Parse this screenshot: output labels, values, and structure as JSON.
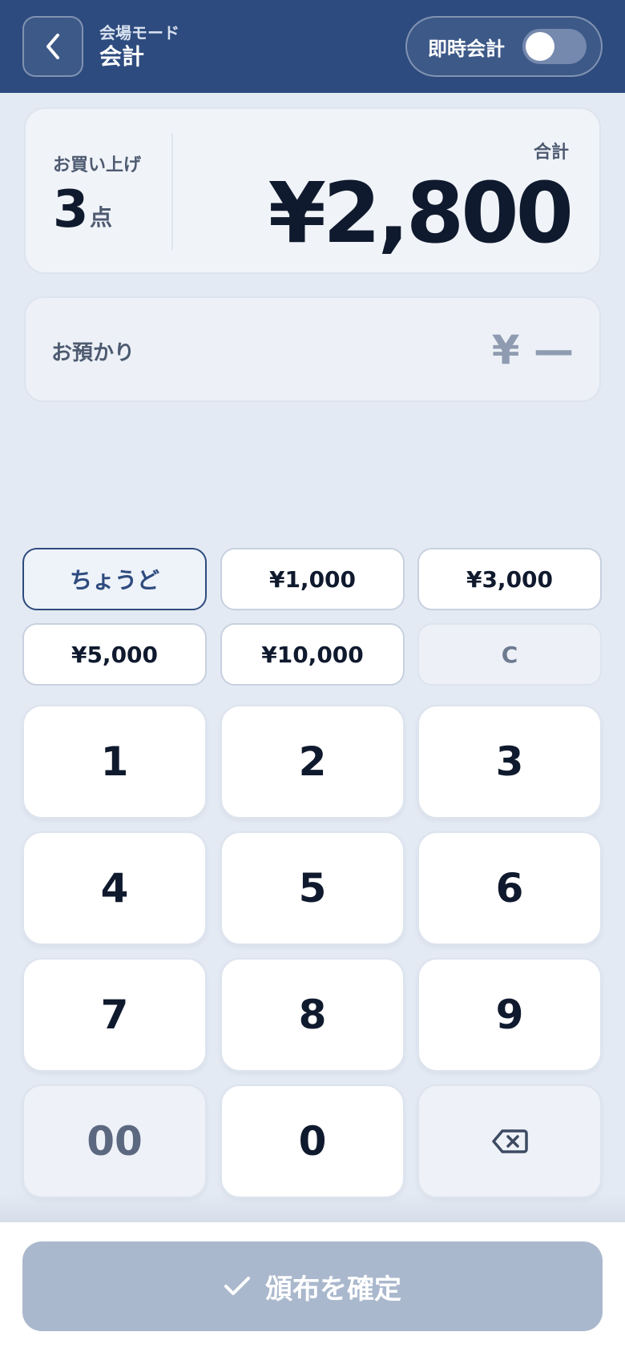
{
  "header": {
    "subtitle": "会場モード",
    "title": "会計",
    "instant_label": "即時会計",
    "instant_enabled": false
  },
  "summary": {
    "count_label": "お買い上げ",
    "count": "3",
    "count_unit": "点",
    "total_label": "合計",
    "total": "¥2,800"
  },
  "deposit": {
    "label": "お預かり",
    "value": "¥ —"
  },
  "quick_amounts": {
    "exact": "ちょうど",
    "q1000": "¥1,000",
    "q3000": "¥3,000",
    "q5000": "¥5,000",
    "q10000": "¥10,000",
    "clear": "C"
  },
  "keypad": {
    "k1": "1",
    "k2": "2",
    "k3": "3",
    "k4": "4",
    "k5": "5",
    "k6": "6",
    "k7": "7",
    "k8": "8",
    "k9": "9",
    "k00": "00",
    "k0": "0"
  },
  "footer": {
    "confirm_label": "頒布を確定"
  },
  "icons": {
    "back": "chevron-left-icon",
    "backspace": "backspace-icon",
    "confirm": "check-icon"
  },
  "colors": {
    "header_bg": "#2d4b7e",
    "page_bg": "#e4eaf3",
    "confirm_disabled": "#aab8cd"
  }
}
